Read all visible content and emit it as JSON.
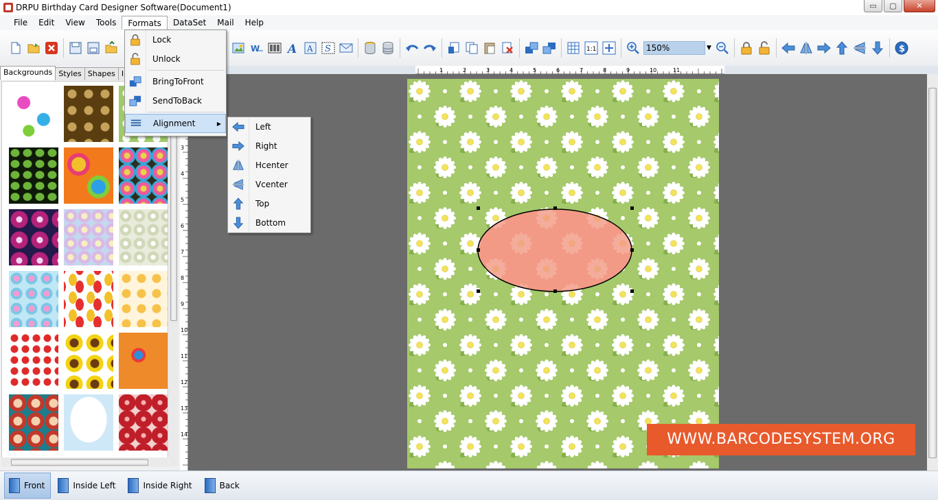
{
  "window": {
    "title": "DRPU Birthday Card Designer Software(Document1)",
    "controls": {
      "minimize": "▭",
      "maximize": "▢",
      "close": "✕"
    }
  },
  "menubar": {
    "items": [
      "File",
      "Edit",
      "View",
      "Tools",
      "Formats",
      "DataSet",
      "Mail",
      "Help"
    ],
    "active": "Formats"
  },
  "toolbar": {
    "zoom_value": "150%"
  },
  "left_panel": {
    "tabs": [
      "Backgrounds",
      "Styles",
      "Shapes",
      "In"
    ],
    "active_tab": "Backgrounds"
  },
  "formats_menu": {
    "items": [
      {
        "label": "Lock",
        "icon": "lock-icon"
      },
      {
        "label": "Unlock",
        "icon": "unlock-icon"
      },
      {
        "label": "BringToFront",
        "icon": "bring-to-front-icon"
      },
      {
        "label": "SendToBack",
        "icon": "send-to-back-icon"
      },
      {
        "label": "Alignment",
        "icon": "alignment-icon"
      }
    ]
  },
  "alignment_submenu": {
    "items": [
      {
        "label": "Left",
        "icon": "arrow-left-icon"
      },
      {
        "label": "Right",
        "icon": "arrow-right-icon"
      },
      {
        "label": "Hcenter",
        "icon": "hcenter-icon"
      },
      {
        "label": "Vcenter",
        "icon": "vcenter-icon"
      },
      {
        "label": "Top",
        "icon": "arrow-up-icon"
      },
      {
        "label": "Bottom",
        "icon": "arrow-down-icon"
      }
    ]
  },
  "rulers": {
    "h_labels": [
      "1",
      "2",
      "3",
      "4",
      "5",
      "6",
      "7",
      "8",
      "9",
      "10",
      "11"
    ],
    "v_labels": [
      "3",
      "4",
      "5",
      "6",
      "7",
      "8",
      "9",
      "10",
      "11",
      "12",
      "13",
      "14"
    ]
  },
  "pages": {
    "items": [
      "Front",
      "Inside Left",
      "Inside Right",
      "Back"
    ],
    "active": "Front"
  },
  "watermark": "WWW.BARCODESYSTEM.ORG",
  "colors": {
    "card_background": "#a5c96b",
    "ellipse_fill": "#f29a85",
    "watermark_bg": "#e85a2c",
    "canvas_bg": "#6b6b6b"
  }
}
